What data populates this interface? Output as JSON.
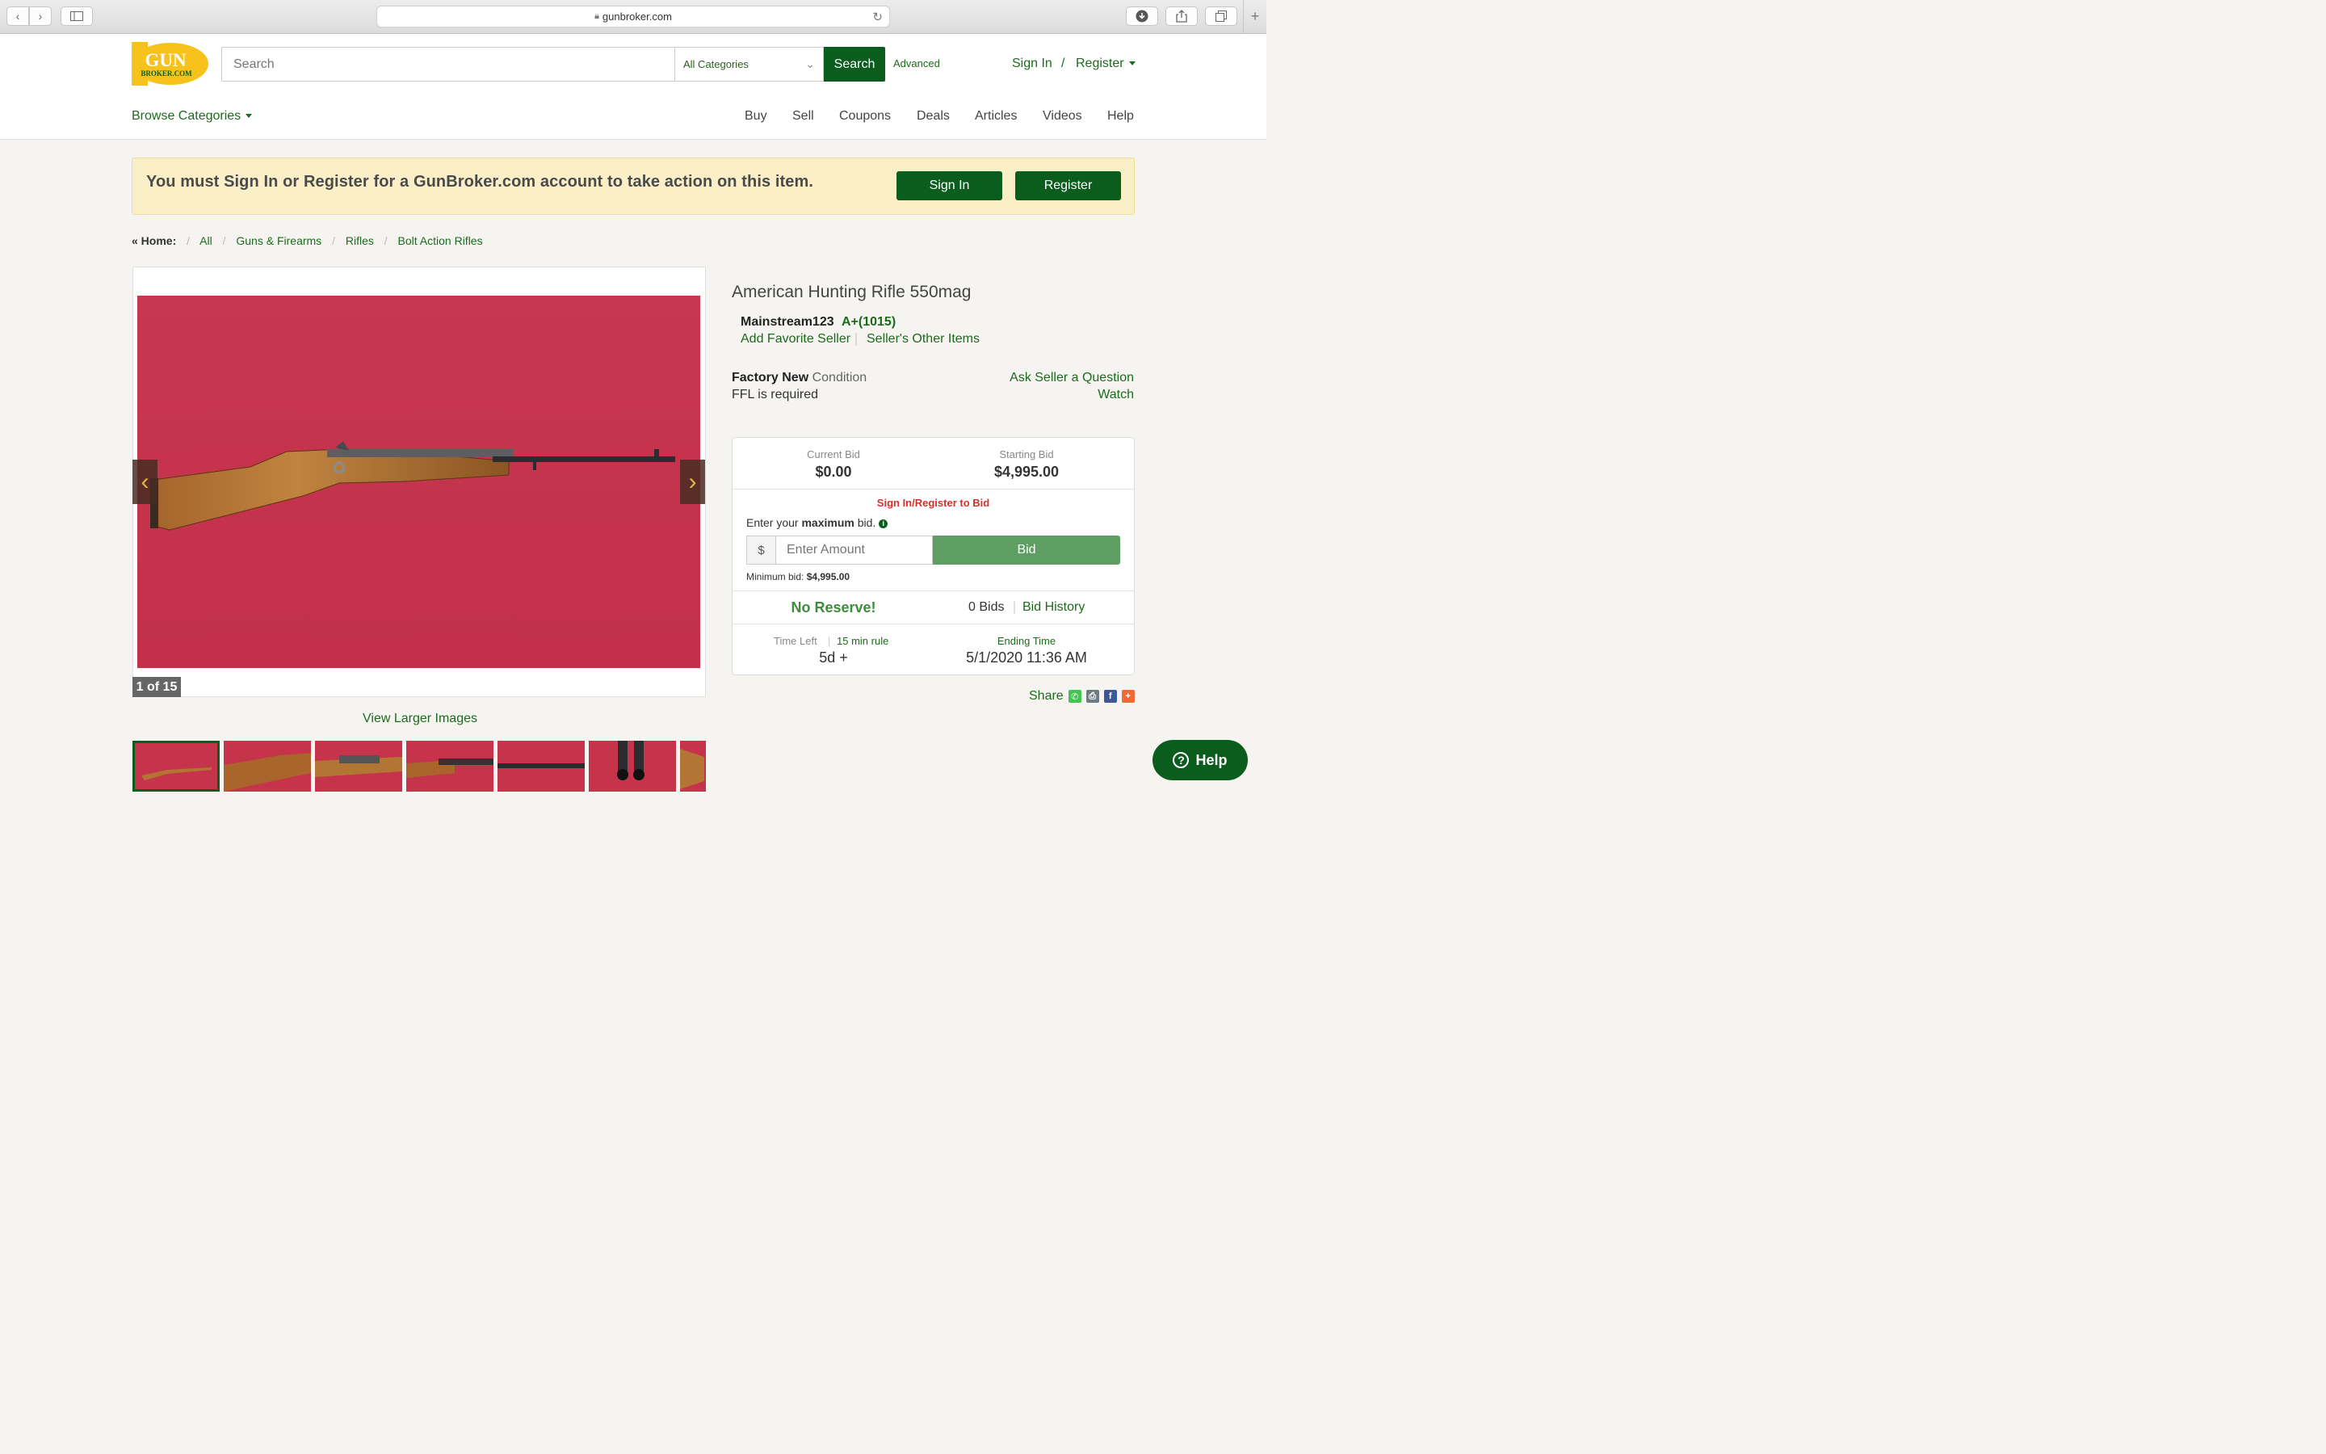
{
  "browser": {
    "url": "gunbroker.com"
  },
  "header": {
    "logo_top": "GUN",
    "logo_bottom": "BROKER.COM",
    "search_placeholder": "Search",
    "category": "All Categories",
    "search_button": "Search",
    "advanced": "Advanced",
    "sign_in": "Sign In",
    "slash": "/",
    "register": "Register",
    "browse": "Browse Categories",
    "nav": [
      "Buy",
      "Sell",
      "Coupons",
      "Deals",
      "Articles",
      "Videos",
      "Help"
    ]
  },
  "notice": {
    "text": "You must Sign In or Register for a GunBroker.com account to take action on this item.",
    "sign_in": "Sign In",
    "register": "Register"
  },
  "breadcrumb": {
    "home": "« Home:",
    "items": [
      "All",
      "Guns & Firearms",
      "Rifles",
      "Bolt Action Rifles"
    ]
  },
  "gallery": {
    "counter": "1 of 15",
    "view_larger": "View Larger Images"
  },
  "item": {
    "title": "American Hunting Rifle 550mag",
    "seller": "Mainstream123",
    "rating": "A+(1015)",
    "add_favorite": "Add Favorite Seller",
    "other_items": "Seller's Other Items",
    "condition_strong": "Factory New",
    "condition_word": "Condition",
    "ffl": "FFL is required",
    "ask": "Ask Seller a Question",
    "watch": "Watch"
  },
  "bid": {
    "current_label": "Current Bid",
    "current_value": "$0.00",
    "starting_label": "Starting Bid",
    "starting_value": "$4,995.00",
    "signin_to_bid": "Sign In/Register to Bid",
    "enter_prefix": "Enter your ",
    "enter_strong": "maximum",
    "enter_suffix": " bid.",
    "currency": "$",
    "amount_placeholder": "Enter Amount",
    "bid_button": "Bid",
    "min_label": "Minimum bid: ",
    "min_value": "$4,995.00",
    "no_reserve": "No Reserve!",
    "bids": "0 Bids",
    "bid_history": "Bid History",
    "time_left_label": "Time Left",
    "rule": "15 min rule",
    "time_left_value": "5d +",
    "ending_label": "Ending Time",
    "ending_value": "5/1/2020 11:36 AM"
  },
  "share": {
    "label": "Share"
  },
  "help_button": "Help",
  "colors": {
    "brand_green": "#0b5d1e",
    "link_green": "#1c6b1c",
    "bid_green": "#5f9e62",
    "notice_bg": "#fbefc7",
    "photo_bg": "#c6344c"
  }
}
